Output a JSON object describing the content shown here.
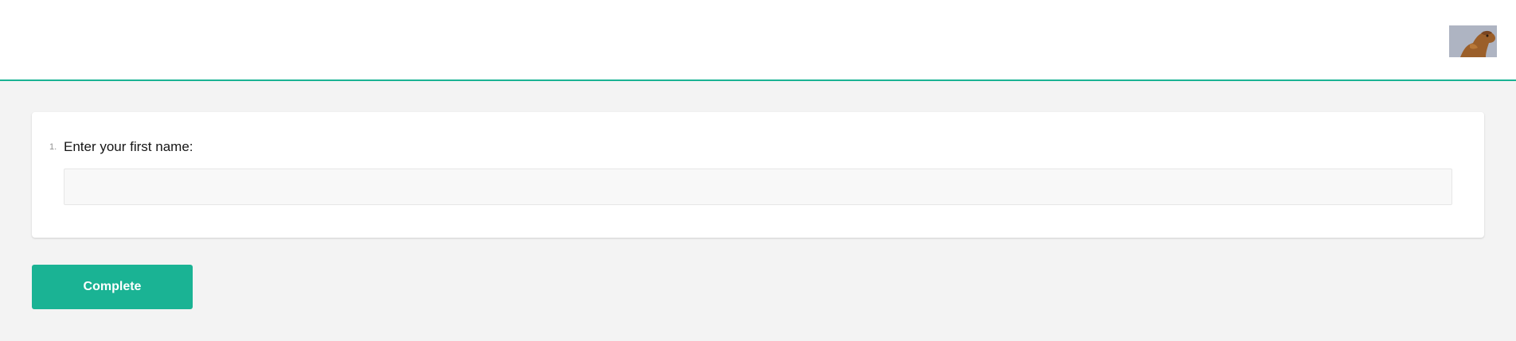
{
  "header": {
    "logo_icon": "camel-logo-icon",
    "accent_color": "#1ab394"
  },
  "survey": {
    "questions": [
      {
        "number": "1.",
        "title": "Enter your first name:",
        "value": "",
        "placeholder": ""
      }
    ],
    "complete_label": "Complete"
  }
}
